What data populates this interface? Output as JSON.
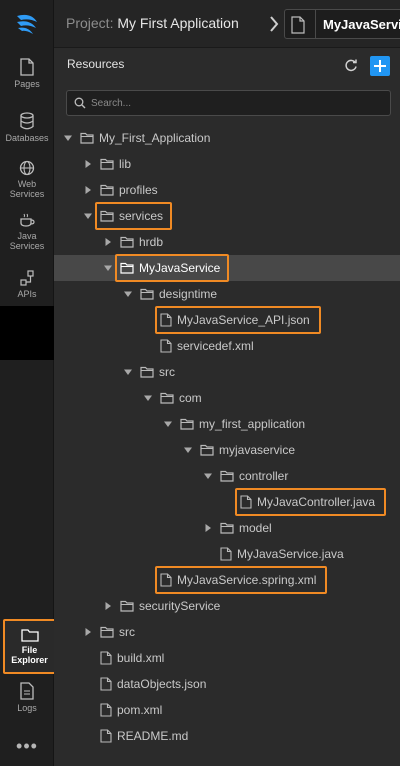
{
  "topbar": {
    "project_prefix": "Project:",
    "project_name": "My First Application",
    "open_file": "MyJavaServi"
  },
  "rail": {
    "items": [
      {
        "label": "Pages"
      },
      {
        "label": "Databases"
      },
      {
        "label": "Web Services"
      },
      {
        "label": "Java Services"
      },
      {
        "label": "APIs"
      }
    ],
    "file_explorer": "File Explorer",
    "logs": "Logs",
    "more": "•••"
  },
  "panel": {
    "title": "Resources",
    "search_placeholder": "Search..."
  },
  "tree": [
    {
      "label": "My_First_Application",
      "depth": 0,
      "kind": "folder",
      "state": "open"
    },
    {
      "label": "lib",
      "depth": 1,
      "kind": "folder",
      "state": "closed"
    },
    {
      "label": "profiles",
      "depth": 1,
      "kind": "folder",
      "state": "closed"
    },
    {
      "label": "services",
      "depth": 1,
      "kind": "folder",
      "state": "open",
      "highlight": true
    },
    {
      "label": "hrdb",
      "depth": 2,
      "kind": "folder",
      "state": "closed"
    },
    {
      "label": "MyJavaService",
      "depth": 2,
      "kind": "folder",
      "state": "open",
      "selected": true,
      "highlight": true
    },
    {
      "label": "designtime",
      "depth": 3,
      "kind": "folder",
      "state": "open"
    },
    {
      "label": "MyJavaService_API.json",
      "depth": 4,
      "kind": "file",
      "highlight": true
    },
    {
      "label": "servicedef.xml",
      "depth": 4,
      "kind": "file"
    },
    {
      "label": "src",
      "depth": 3,
      "kind": "folder",
      "state": "open"
    },
    {
      "label": "com",
      "depth": 4,
      "kind": "folder",
      "state": "open"
    },
    {
      "label": "my_first_application",
      "depth": 5,
      "kind": "folder",
      "state": "open"
    },
    {
      "label": "myjavaservice",
      "depth": 6,
      "kind": "folder",
      "state": "open"
    },
    {
      "label": "controller",
      "depth": 7,
      "kind": "folder",
      "state": "open"
    },
    {
      "label": "MyJavaController.java",
      "depth": 8,
      "kind": "file",
      "highlight": true
    },
    {
      "label": "model",
      "depth": 7,
      "kind": "folder",
      "state": "closed"
    },
    {
      "label": "MyJavaService.java",
      "depth": 7,
      "kind": "file"
    },
    {
      "label": "MyJavaService.spring.xml",
      "depth": 4,
      "kind": "file",
      "highlight": true
    },
    {
      "label": "securityService",
      "depth": 2,
      "kind": "folder",
      "state": "closed"
    },
    {
      "label": "src",
      "depth": 1,
      "kind": "folder",
      "state": "closed"
    },
    {
      "label": "build.xml",
      "depth": 1,
      "kind": "file"
    },
    {
      "label": "dataObjects.json",
      "depth": 1,
      "kind": "file"
    },
    {
      "label": "pom.xml",
      "depth": 1,
      "kind": "file"
    },
    {
      "label": "README.md",
      "depth": 1,
      "kind": "file"
    }
  ],
  "colors": {
    "accent_blue": "#2196f3",
    "highlight_orange": "#f08a24",
    "selected_row": "#484848"
  }
}
